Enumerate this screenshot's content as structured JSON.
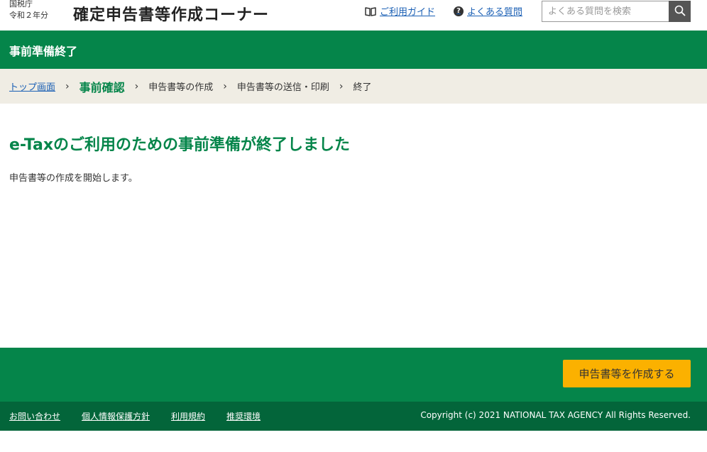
{
  "header": {
    "agency": "国税庁",
    "year": "令和２年分",
    "site_title": "確定申告書等作成コーナー",
    "guide_link": "ご利用ガイド",
    "faq_link": "よくある質問",
    "search_placeholder": "よくある質問を検索",
    "faq_icon_glyph": "?"
  },
  "title_bar": {
    "text": "事前準備終了"
  },
  "breadcrumb": {
    "items": [
      {
        "label": "トップ画面"
      },
      {
        "label": "事前確認"
      },
      {
        "label": "申告書等の作成"
      },
      {
        "label": "申告書等の送信・印刷"
      },
      {
        "label": "終了"
      }
    ],
    "separator": "›"
  },
  "main": {
    "heading": "e-Taxのご利用のための事前準備が終了しました",
    "text": "申告書等の作成を開始します。"
  },
  "action": {
    "primary_button": "申告書等を作成する"
  },
  "footer": {
    "links": [
      "お問い合わせ",
      "個人情報保護方針",
      "利用規約",
      "推奨環境"
    ],
    "copyright": "Copyright (c) 2021 NATIONAL TAX AGENCY All Rights Reserved."
  },
  "colors": {
    "brand_green": "#05854a",
    "footer_green": "#03653a",
    "breadcrumb_bg": "#f0ede4",
    "accent_yellow": "#fbb100",
    "link_blue": "#1a5fb4"
  },
  "icons": {
    "guide": "book-icon",
    "faq": "question-circle-icon",
    "search": "magnifier-icon"
  }
}
